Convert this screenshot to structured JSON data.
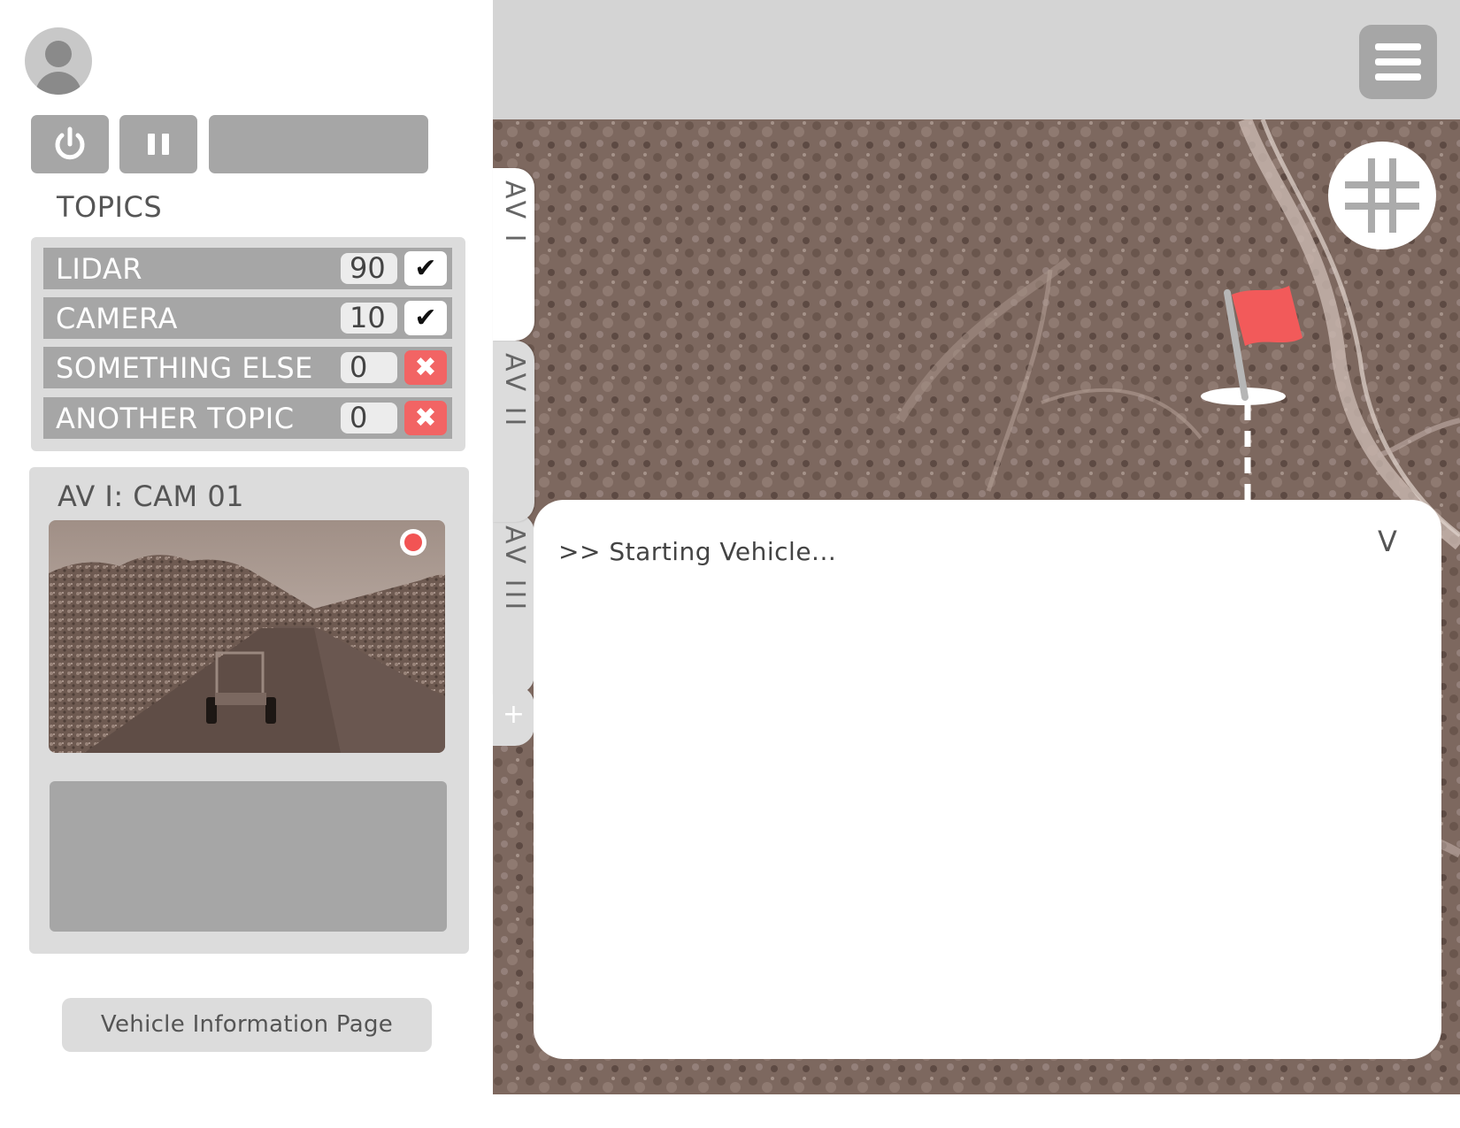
{
  "sidebar": {
    "topics_title": "TOPICS",
    "topics": [
      {
        "name": "LIDAR",
        "count": "90",
        "enabled": true,
        "toggle_glyph": "✔"
      },
      {
        "name": "CAMERA",
        "count": "10",
        "enabled": true,
        "toggle_glyph": "✔"
      },
      {
        "name": "SOMETHING ELSE",
        "count": "0",
        "enabled": false,
        "toggle_glyph": "✖"
      },
      {
        "name": "ANOTHER TOPIC",
        "count": "0",
        "enabled": false,
        "toggle_glyph": "✖"
      }
    ],
    "camera_title": "AV I: CAM 01",
    "vehicle_info_label": "Vehicle Information Page"
  },
  "vehicle_tabs": [
    {
      "label": "AV I",
      "active": true
    },
    {
      "label": "AV II",
      "active": false
    },
    {
      "label": "AV III",
      "active": false
    }
  ],
  "add_tab_label": "+",
  "console": {
    "text": ">> Starting Vehicle...",
    "collapse_label": "V"
  },
  "icons": {
    "power": "power-icon",
    "pause": "pause-icon",
    "menu": "hamburger-menu-icon",
    "grid": "grid-icon",
    "flag": "flag-icon",
    "record": "record-indicator-icon",
    "avatar": "user-avatar-icon"
  },
  "colors": {
    "panel_gray": "#a6a6a6",
    "light_gray": "#dcdcdc",
    "accent_red": "#f26464",
    "map_tone": "#7d685f"
  }
}
